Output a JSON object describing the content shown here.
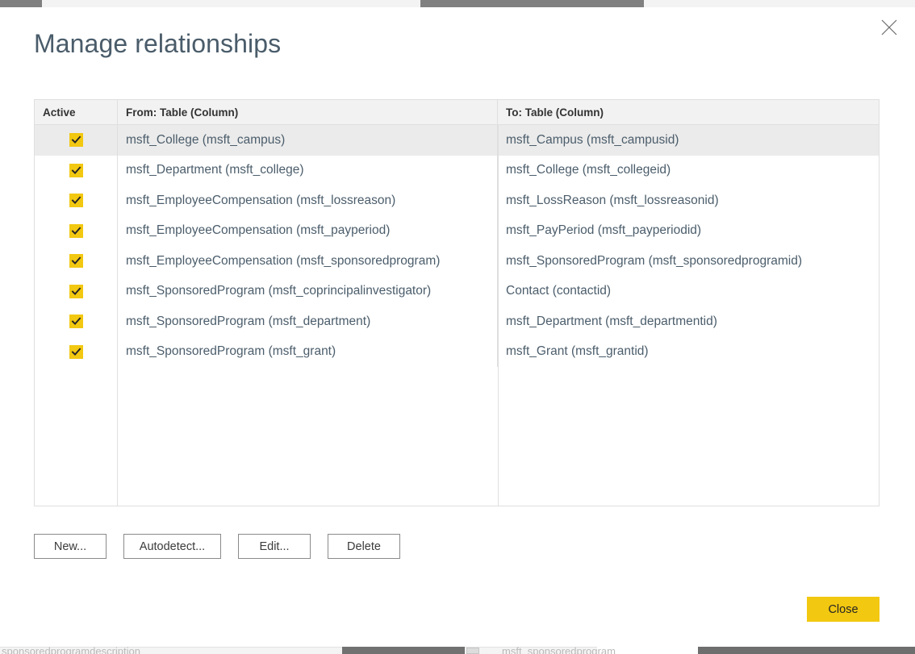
{
  "dialog": {
    "title": "Manage relationships",
    "close_icon": "close-x-icon"
  },
  "grid": {
    "columns": [
      {
        "key": "active",
        "label": "Active"
      },
      {
        "key": "from",
        "label": "From: Table (Column)"
      },
      {
        "key": "to",
        "label": "To: Table (Column)"
      }
    ],
    "rows": [
      {
        "active": true,
        "from": "msft_College (msft_campus)",
        "to": "msft_Campus (msft_campusid)",
        "selected": true
      },
      {
        "active": true,
        "from": "msft_Department (msft_college)",
        "to": "msft_College (msft_collegeid)",
        "selected": false
      },
      {
        "active": true,
        "from": "msft_EmployeeCompensation (msft_lossreason)",
        "to": "msft_LossReason (msft_lossreasonid)",
        "selected": false
      },
      {
        "active": true,
        "from": "msft_EmployeeCompensation (msft_payperiod)",
        "to": "msft_PayPeriod (msft_payperiodid)",
        "selected": false
      },
      {
        "active": true,
        "from": "msft_EmployeeCompensation (msft_sponsoredprogram)",
        "to": "msft_SponsoredProgram (msft_sponsoredprogramid)",
        "selected": false
      },
      {
        "active": true,
        "from": "msft_SponsoredProgram (msft_coprincipalinvestigator)",
        "to": "Contact (contactid)",
        "selected": false
      },
      {
        "active": true,
        "from": "msft_SponsoredProgram (msft_department)",
        "to": "msft_Department (msft_departmentid)",
        "selected": false
      },
      {
        "active": true,
        "from": "msft_SponsoredProgram (msft_grant)",
        "to": "msft_Grant (msft_grantid)",
        "selected": false
      }
    ]
  },
  "buttons": {
    "new": "New...",
    "autodetect": "Autodetect...",
    "edit": "Edit...",
    "delete": "Delete",
    "close": "Close"
  },
  "background": {
    "bottom_label_left": "sponsoredprogramdescription",
    "bottom_label_right": "msft_sponsoredprogram"
  },
  "colors": {
    "accent_yellow": "#f2c811",
    "text_slate": "#4b5d6b",
    "header_bg": "#f2f2f2",
    "selected_row_bg": "#ebebeb",
    "border": "#dfdfdf"
  }
}
